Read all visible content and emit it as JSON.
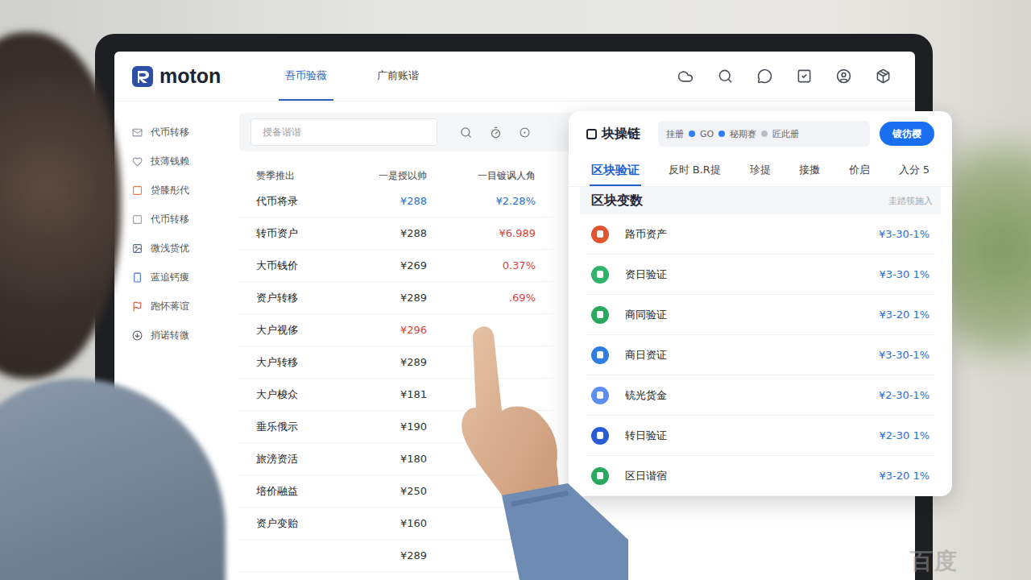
{
  "brand": "moton",
  "nav_tabs": [
    {
      "label": "吾币验薇",
      "selected": true
    },
    {
      "label": "广前账谐",
      "selected": false
    }
  ],
  "sidebar": {
    "items": [
      {
        "label": "代币转移",
        "color": "#8a93a6"
      },
      {
        "label": "技薄钱赖",
        "color": "#8a93a6"
      },
      {
        "label": "贷膝彤代",
        "color": "#e07a3a"
      },
      {
        "label": "代币转移",
        "color": "#9aa0aa"
      },
      {
        "label": "微浅货优",
        "color": "#5a6b8a"
      },
      {
        "label": "蓝追钙痩",
        "color": "#3d6fd8"
      },
      {
        "label": "跑怀蒋谊",
        "color": "#e0553a"
      },
      {
        "label": "捎诺转微",
        "color": "#5a6270"
      }
    ]
  },
  "search": {
    "placeholder": "授备谐谐"
  },
  "table": {
    "columns": [
      "赞季推出",
      "一是授以帅",
      "一目镀讽人角"
    ],
    "rows": [
      {
        "name": "代币将录",
        "value": "¥288",
        "value_color": "#2a6fd6",
        "change": "¥2.28%",
        "change_color": "#2a6fd6"
      },
      {
        "name": "转币资户",
        "value": "¥288",
        "value_color": "#333333",
        "change": "¥6.989",
        "change_color": "#d9453a"
      },
      {
        "name": "大币钱价",
        "value": "¥269",
        "value_color": "#333333",
        "change": "0.37%",
        "change_color": "#d9453a"
      },
      {
        "name": "资户转移",
        "value": "¥289",
        "value_color": "#333333",
        "change": ".69%",
        "change_color": "#d9453a"
      },
      {
        "name": "大户视侈",
        "value": "¥296",
        "value_color": "#d9453a",
        "change": "",
        "change_color": "#333333"
      },
      {
        "name": "大户转移",
        "value": "¥289",
        "value_color": "#333333",
        "change": "",
        "change_color": "#333333"
      },
      {
        "name": "大户梭众",
        "value": "¥181",
        "value_color": "#333333",
        "change": "",
        "change_color": "#333333"
      },
      {
        "name": "垂乐俄示",
        "value": "¥190",
        "value_color": "#333333",
        "change": "",
        "change_color": "#333333"
      },
      {
        "name": "旅滂资活",
        "value": "¥180",
        "value_color": "#333333",
        "change": "",
        "change_color": "#333333"
      },
      {
        "name": "培价融益",
        "value": "¥250",
        "value_color": "#333333",
        "change": "",
        "change_color": "#333333"
      },
      {
        "name": "资户变贻",
        "value": "¥160",
        "value_color": "#333333",
        "change": "",
        "change_color": "#333333"
      },
      {
        "name": "",
        "value": "¥289",
        "value_color": "#333333",
        "change": "",
        "change_color": "#333333"
      }
    ]
  },
  "panel": {
    "title": "块操链",
    "filters": [
      {
        "label": "挂册",
        "dot": "#2d7ff9"
      },
      {
        "label": "GO",
        "dot": "#2d7ff9"
      },
      {
        "label": "秘期赛",
        "dot": "#b8bcc4"
      },
      {
        "label": "匠此册",
        "dot": ""
      }
    ],
    "button": "镀彷樱",
    "tabs": [
      {
        "label": "区块验证",
        "selected": true
      },
      {
        "label": "反时 B.R提",
        "selected": false
      },
      {
        "label": "珍提",
        "selected": false
      },
      {
        "label": "接擞",
        "selected": false
      },
      {
        "label": "价启",
        "selected": false
      },
      {
        "label": "入分 5",
        "selected": false
      }
    ],
    "section_title": "区块变数",
    "section_hint": "圭踏筷施入",
    "items": [
      {
        "name": "路币资产",
        "value": "¥3-30-1%",
        "color": "#e0552f"
      },
      {
        "name": "资日验证",
        "value": "¥3-30 1%",
        "color": "#2fb36a"
      },
      {
        "name": "商同验证",
        "value": "¥3-20 1%",
        "color": "#27a960"
      },
      {
        "name": "商日资证",
        "value": "¥3-30-1%",
        "color": "#2f7de0"
      },
      {
        "name": "铳光货金",
        "value": "¥2-30-1%",
        "color": "#5b8ef0"
      },
      {
        "name": "转日验证",
        "value": "¥2-30 1%",
        "color": "#2c5bd6"
      },
      {
        "name": "区日谐宿",
        "value": "¥3-20 1%",
        "color": "#27a960"
      }
    ]
  },
  "watermark": "百度"
}
